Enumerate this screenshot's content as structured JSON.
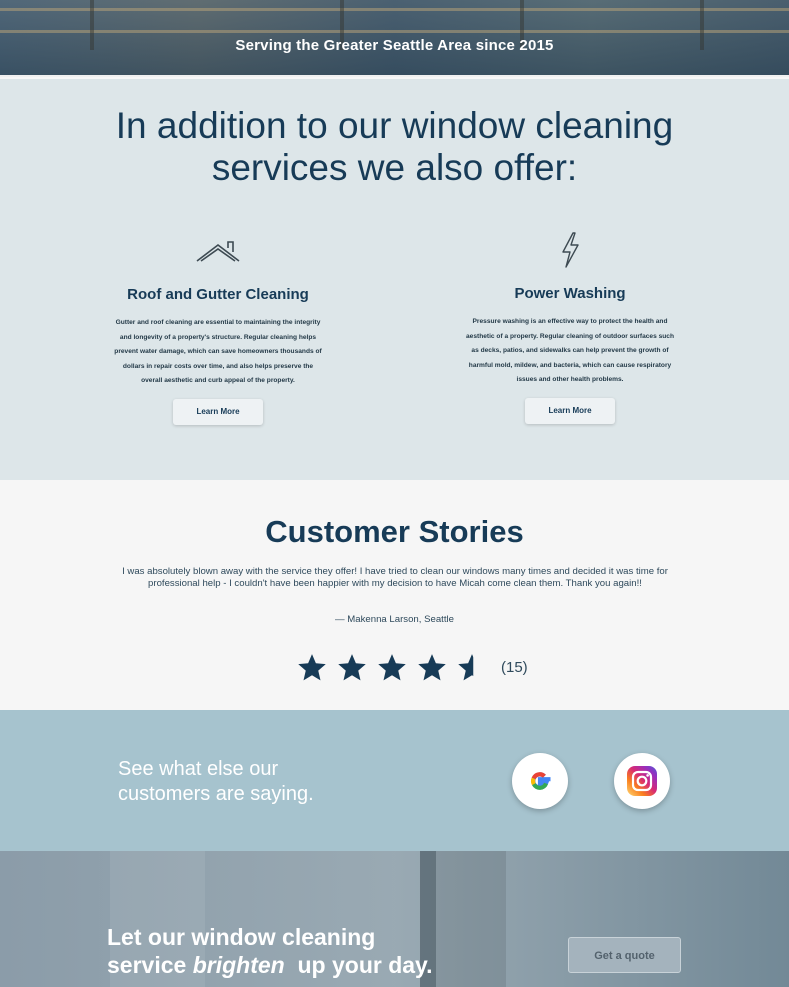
{
  "hero": {
    "tagline": "Serving the Greater Seattle Area since 2015"
  },
  "services": {
    "heading_line1": "In addition to our window cleaning",
    "heading_line2": "services we also offer:",
    "items": [
      {
        "icon": "roof-icon",
        "title": "Roof and Gutter Cleaning",
        "description": "Gutter and roof cleaning are essential to maintaining the integrity and longevity of a property's structure. Regular cleaning helps prevent water damage, which can save homeowners thousands of dollars in repair costs over time, and also helps preserve the overall aesthetic and curb appeal of the property.",
        "button": "Learn More"
      },
      {
        "icon": "lightning-bolt-icon",
        "title": "Power Washing",
        "description": "Pressure washing is an effective way to protect the health and aesthetic of a property. Regular cleaning of outdoor surfaces such as decks, patios, and sidewalks can help prevent the growth of harmful mold, mildew, and bacteria, which can cause respiratory issues and other health problems.",
        "button": "Learn More"
      }
    ]
  },
  "stories": {
    "heading": "Customer Stories",
    "quote": "I was absolutely blown away with the service they offer! I have tried to clean our windows many times and decided it was time for professional help - I couldn't have been happier with my decision to have Micah come clean them. Thank you again!!",
    "author": "— Makenna Larson, Seattle",
    "rating": 4.5,
    "rating_count": "(15)"
  },
  "reviews": {
    "text": "See what else our customers are saying.",
    "links": [
      {
        "icon": "google-icon"
      },
      {
        "icon": "instagram-icon"
      }
    ]
  },
  "cta": {
    "line1": "Let our window cleaning",
    "line2_prefix": "service ",
    "line2_emphasis": "brighten",
    "line2_suffix": "  up your day.",
    "button": "Get a quote"
  },
  "colors": {
    "primary": "#173b57",
    "services_bg": "#dde6e9",
    "stories_bg": "#f6f6f6",
    "reviews_bg": "#a6c3ce",
    "cta_bg": "#7d95a3"
  }
}
